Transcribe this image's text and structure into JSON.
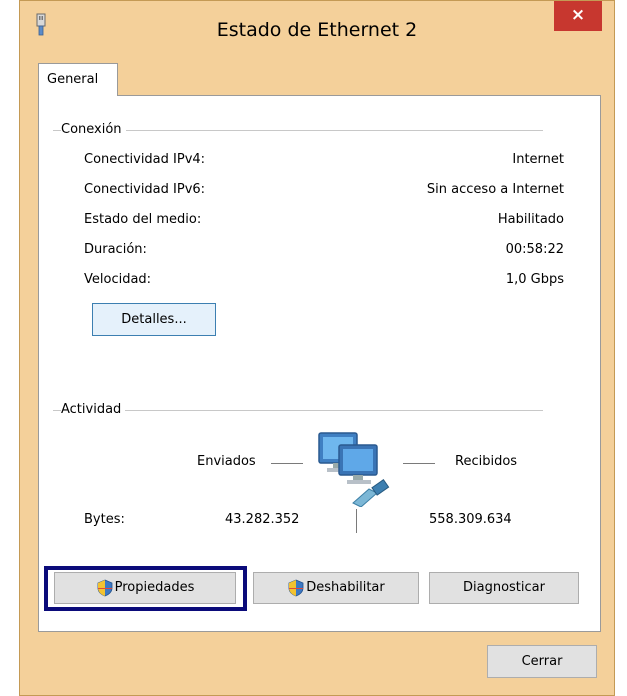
{
  "window": {
    "title": "Estado de Ethernet 2",
    "close_glyph": "×",
    "icon": "ethernet-connector-icon"
  },
  "tabs": [
    {
      "label": "General"
    }
  ],
  "connection": {
    "group_label": "Conexión",
    "rows": [
      {
        "label": "Conectividad IPv4:",
        "value": "Internet"
      },
      {
        "label": "Conectividad IPv6:",
        "value": "Sin acceso a Internet"
      },
      {
        "label": "Estado del medio:",
        "value": "Habilitado"
      },
      {
        "label": "Duración:",
        "value": "00:58:22"
      },
      {
        "label": "Velocidad:",
        "value": "1,0 Gbps"
      }
    ],
    "details_button": "Detalles..."
  },
  "activity": {
    "group_label": "Actividad",
    "sent_label": "Enviados",
    "received_label": "Recibidos",
    "bytes_label": "Bytes:",
    "bytes_sent": "43.282.352",
    "bytes_received": "558.309.634",
    "icon": "network-computers-icon"
  },
  "buttons": {
    "properties": "Propiedades",
    "disable": "Deshabilitar",
    "diagnose": "Diagnosticar",
    "close": "Cerrar"
  },
  "colors": {
    "window_frame": "#f4d09a",
    "close_button": "#c7372f",
    "highlight_box": "#0b0b7a"
  }
}
